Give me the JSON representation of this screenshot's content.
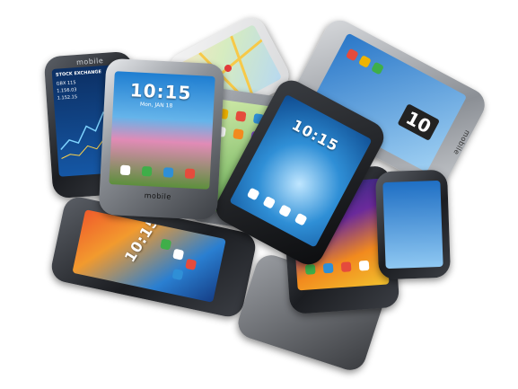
{
  "phones": {
    "center_front": {
      "brand": "mobile",
      "clock": "10:15",
      "date": "Mon, JAN 18"
    },
    "top_left": {
      "brand": "mobile",
      "stock_title": "STOCK EXCHANGE",
      "stock_lines": [
        "GBX 115",
        "1.156.03",
        "1.152.15"
      ]
    },
    "black_tilted": {
      "clock": "10:15"
    },
    "bottom_left": {
      "clock": "10:15"
    },
    "right_back": {
      "brand": "mobile",
      "clock": "10"
    }
  },
  "colors": {
    "body_dark": "#1b1d21",
    "chrome": "#c9ccd1",
    "sky_blue": "#2f8fd6",
    "orange": "#f28a1e",
    "green": "#3fae49"
  }
}
